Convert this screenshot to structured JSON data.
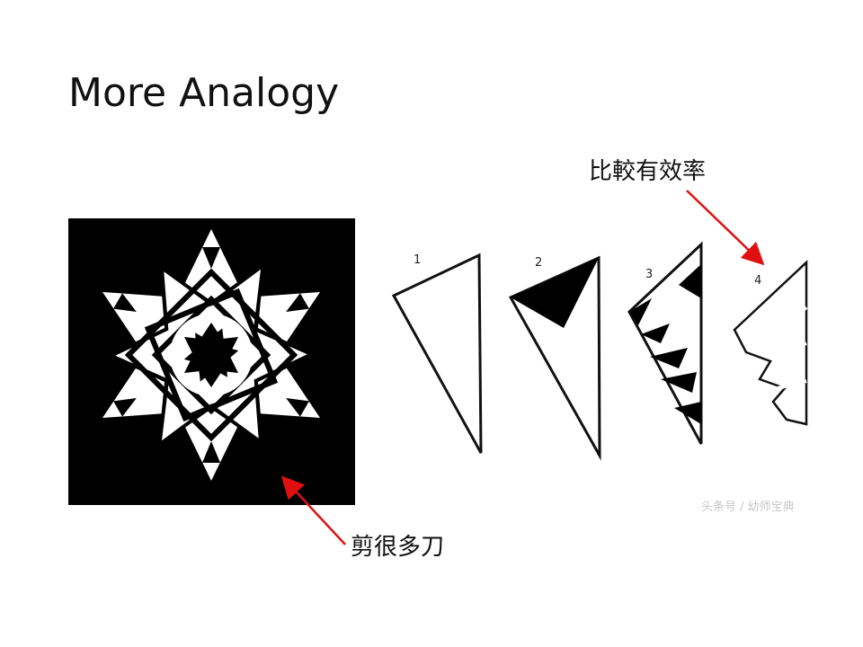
{
  "slide": {
    "title": "More Analogy",
    "annotation_top": "比較有效率",
    "annotation_bottom": "剪很多刀",
    "arrow_color": "#e01010"
  },
  "steps": {
    "labels": [
      "1",
      "2",
      "3",
      "4"
    ]
  },
  "watermark": "头条号 / 幼师宝典"
}
